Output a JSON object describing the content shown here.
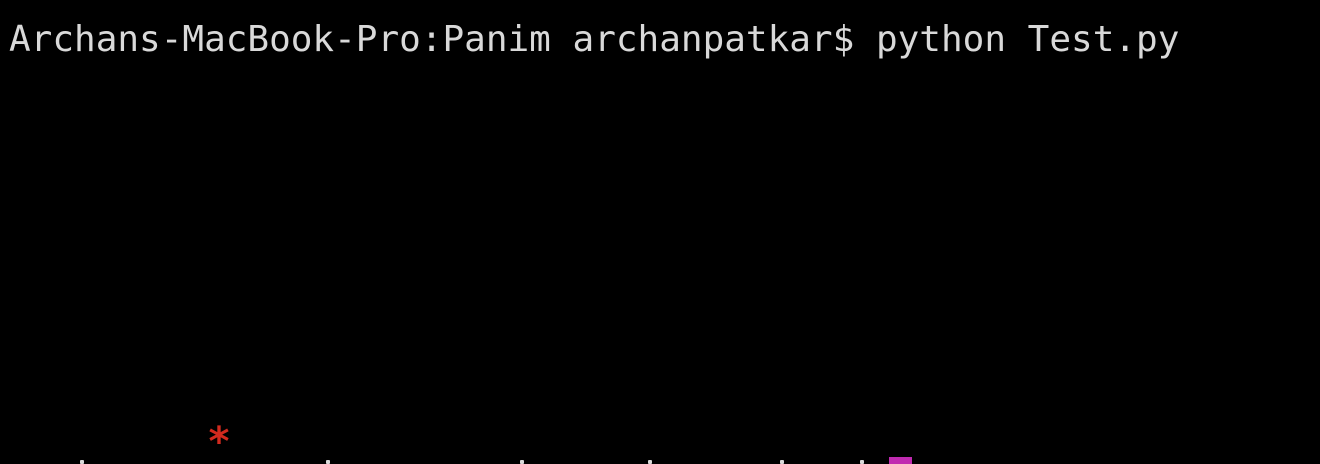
{
  "terminal": {
    "prompt": "Archans-MacBook-Pro:Panim archanpatkar$ python Test.py",
    "output_star": "*",
    "colors": {
      "background": "#000000",
      "text": "#d9d9d9",
      "star": "#d22a1e",
      "cursor": "#c02ab0"
    }
  }
}
